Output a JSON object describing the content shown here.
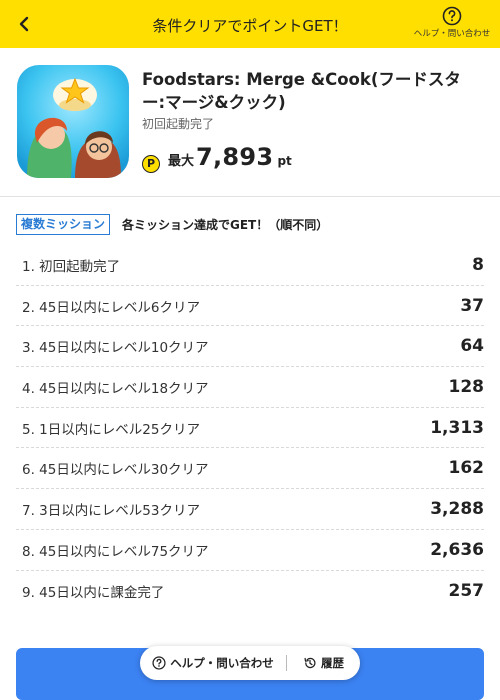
{
  "header": {
    "title": "条件クリアでポイントGET！",
    "help_label": "ヘルプ・問い合わせ"
  },
  "app": {
    "name": "Foodstars: Merge &Cook(フードスター:マージ&クック)",
    "subtitle": "初回起動完了",
    "badge": "P",
    "points_prefix": "最大",
    "points": "7,893",
    "points_unit": "pt"
  },
  "missions": {
    "tag": "複数ミッション",
    "description": "各ミッション達成でGET！（順不同）",
    "items": [
      {
        "label": "1. 初回起動完了",
        "points": "8"
      },
      {
        "label": "2. 45日以内にレベル6クリア",
        "points": "37"
      },
      {
        "label": "3. 45日以内にレベル10クリア",
        "points": "64"
      },
      {
        "label": "4. 45日以内にレベル18クリア",
        "points": "128"
      },
      {
        "label": "5. 1日以内にレベル25クリア",
        "points": "1,313"
      },
      {
        "label": "6. 45日以内にレベル30クリア",
        "points": "162"
      },
      {
        "label": "7. 3日以内にレベル53クリア",
        "points": "3,288"
      },
      {
        "label": "8. 45日以内にレベル75クリア",
        "points": "2,636"
      },
      {
        "label": "9. 45日以内に課金完了",
        "points": "257"
      }
    ]
  },
  "bottom": {
    "button_label": "",
    "help_label": "ヘルプ・問い合わせ",
    "history_label": "履歴"
  },
  "colors": {
    "header_bg": "#ffdf00",
    "accent_blue": "#3b82f2",
    "tag_blue": "#2a7bd4"
  },
  "icons": [
    "chevron-left-icon",
    "question-circle-icon",
    "history-icon",
    "point-badge-icon"
  ]
}
